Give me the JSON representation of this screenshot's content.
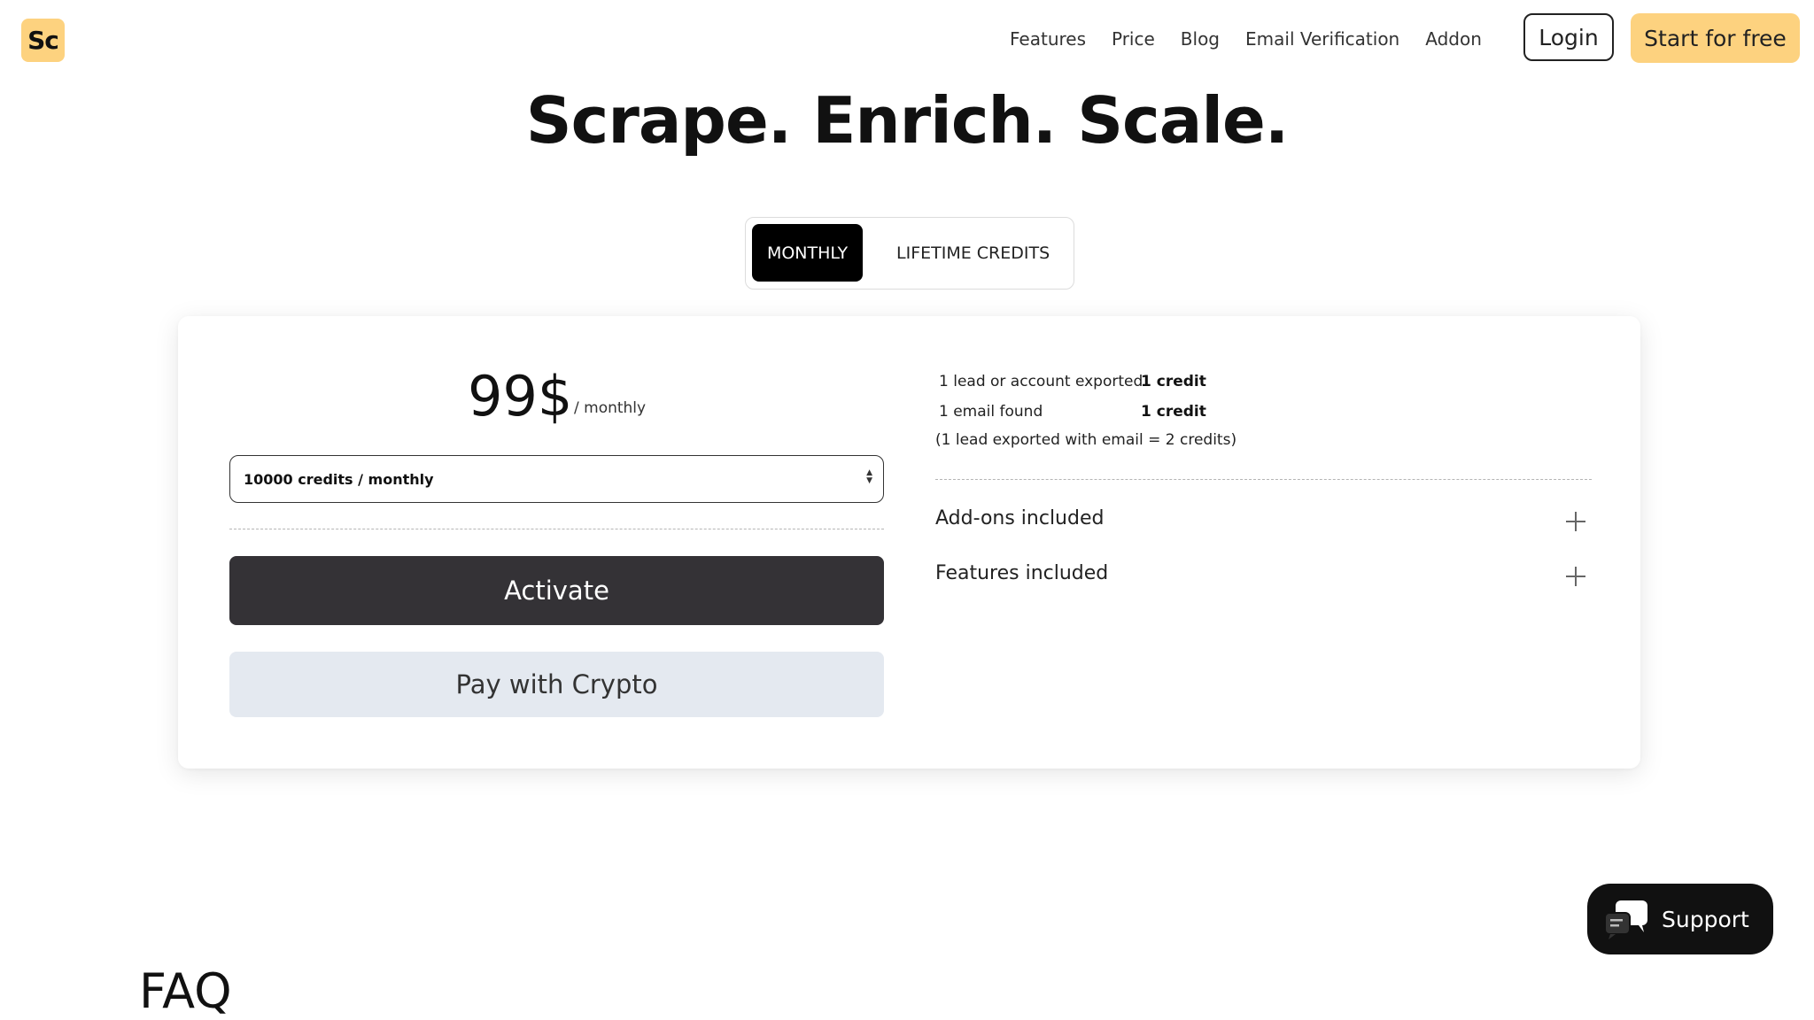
{
  "brand": {
    "logo_text": "Sc",
    "accent": "#fdd27f"
  },
  "nav": {
    "items": [
      {
        "label": "Features"
      },
      {
        "label": "Price"
      },
      {
        "label": "Blog"
      },
      {
        "label": "Email Verification"
      },
      {
        "label": "Addon"
      }
    ],
    "login_label": "Login",
    "start_label": "Start for free"
  },
  "hero": {
    "title": "Scrape. Enrich. Scale."
  },
  "billing_toggle": {
    "tabs": [
      {
        "label": "MONTHLY",
        "selected": true
      },
      {
        "label": "LIFETIME CREDITS",
        "selected": false
      }
    ]
  },
  "plan": {
    "price": "99$",
    "period": "/ monthly",
    "credits_select_value": "10000 credits / monthly",
    "activate_label": "Activate",
    "crypto_label": "Pay with Crypto"
  },
  "credits_info": {
    "rows": [
      {
        "label": "1 lead or account exported",
        "value": "1 credit"
      },
      {
        "label": "1 email found",
        "value": "1 credit"
      }
    ],
    "note": "(1 lead exported with email = 2 credits)"
  },
  "accordions": [
    {
      "label": "Add-ons included",
      "icon": "plus-icon"
    },
    {
      "label": "Features included",
      "icon": "plus-icon"
    }
  ],
  "support": {
    "label": "Support",
    "icon": "chat-icon"
  },
  "faq": {
    "title": "FAQ"
  }
}
